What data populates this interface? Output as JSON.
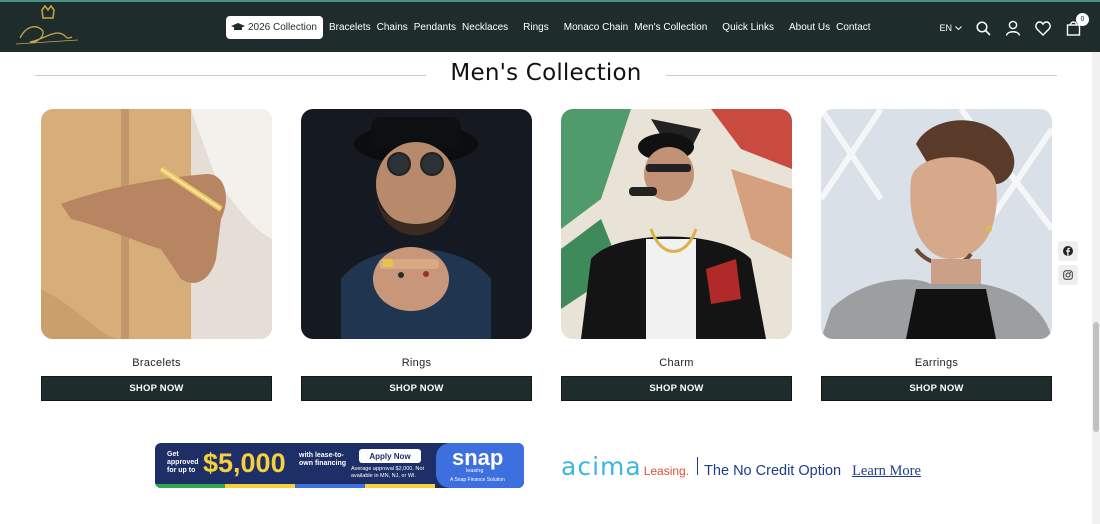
{
  "header": {
    "logo_icon": "crown-signature-logo",
    "nav": [
      {
        "label": "2026 Collection",
        "highlight": true
      },
      {
        "label": "Bracelets"
      },
      {
        "label": "Chains"
      },
      {
        "label": "Pendants"
      },
      {
        "label": "Necklaces"
      },
      {
        "label": "Rings"
      },
      {
        "label": "Monaco Chain"
      },
      {
        "label": "Men's Collection"
      },
      {
        "label": "Quick Links"
      },
      {
        "label": "About Us"
      },
      {
        "label": "Contact"
      }
    ],
    "language": "EN",
    "cart_count": "0",
    "colors": {
      "bar": "#1e2d2b",
      "accent_top": "#4a8f86"
    }
  },
  "section": {
    "title": "Men's Collection"
  },
  "cards": [
    {
      "label": "Bracelets",
      "button": "SHOP NOW",
      "image": "hand-in-pocket-gold-bracelet"
    },
    {
      "label": "Rings",
      "button": "SHOP NOW",
      "image": "bearded-man-fist-rings"
    },
    {
      "label": "Charm",
      "button": "SHOP NOW",
      "image": "rapper-with-chain-charm"
    },
    {
      "label": "Earrings",
      "button": "SHOP NOW",
      "image": "man-with-earring-profile"
    }
  ],
  "social": [
    "facebook-icon",
    "instagram-icon"
  ],
  "snap_banner": {
    "get_approved": "Get approved for up to",
    "amount": "$5,000",
    "with_text": "with lease-to-own financing",
    "apply_label": "Apply Now",
    "fine_print": "Average approval $2,000. Not available in MN, NJ, or WI.",
    "brand": "snap",
    "brand_sub": "leasing",
    "brand_sub2": "A Snap Finance Solution"
  },
  "acima_banner": {
    "brand": "acima",
    "brand_suffix": "Leasing.",
    "tagline": "The No Credit Option",
    "learn_more": "Learn More"
  }
}
